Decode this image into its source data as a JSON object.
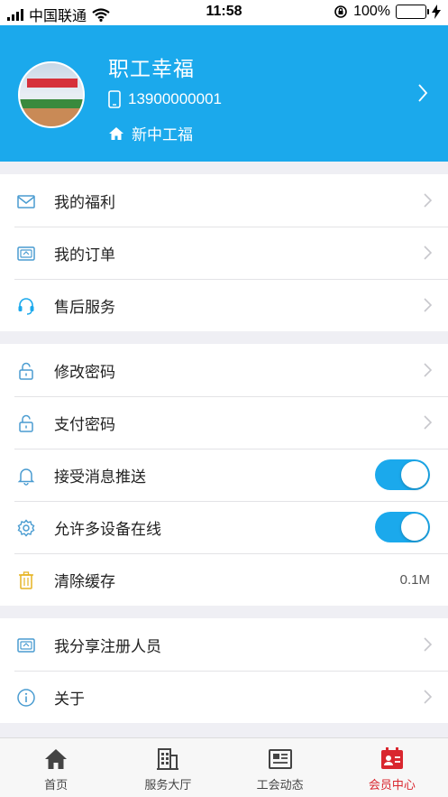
{
  "status_bar": {
    "carrier": "中国联通",
    "time": "11:58",
    "battery": "100%"
  },
  "profile": {
    "name": "职工幸福",
    "phone": "13900000001",
    "organization": "新中工福",
    "icons": [
      "avatar-image",
      "phone-icon",
      "home-icon",
      "chevron-right-icon"
    ]
  },
  "menu": {
    "group1": [
      {
        "label": "我的福利",
        "icon": "mail-icon"
      },
      {
        "label": "我的订单",
        "icon": "order-card-icon"
      },
      {
        "label": "售后服务",
        "icon": "headset-icon"
      }
    ],
    "group2": [
      {
        "label": "修改密码",
        "icon": "unlock-icon"
      },
      {
        "label": "支付密码",
        "icon": "unlock-icon"
      },
      {
        "label": "接受消息推送",
        "icon": "bell-icon",
        "toggle": true
      },
      {
        "label": "允许多设备在线",
        "icon": "gear-icon",
        "toggle": true
      },
      {
        "label": "清除缓存",
        "icon": "trash-icon",
        "value": "0.1M"
      }
    ],
    "group3": [
      {
        "label": "我分享注册人员",
        "icon": "share-card-icon"
      },
      {
        "label": "关于",
        "icon": "info-icon"
      }
    ]
  },
  "tabbar": {
    "tabs": [
      {
        "label": "首页",
        "icon": "home-icon"
      },
      {
        "label": "服务大厅",
        "icon": "building-icon"
      },
      {
        "label": "工会动态",
        "icon": "news-icon"
      },
      {
        "label": "会员中心",
        "icon": "member-card-icon"
      }
    ],
    "active_index": 3
  },
  "colors": {
    "accent": "#1ba9ec",
    "active_tab": "#d9262e",
    "background": "#efeff4"
  }
}
